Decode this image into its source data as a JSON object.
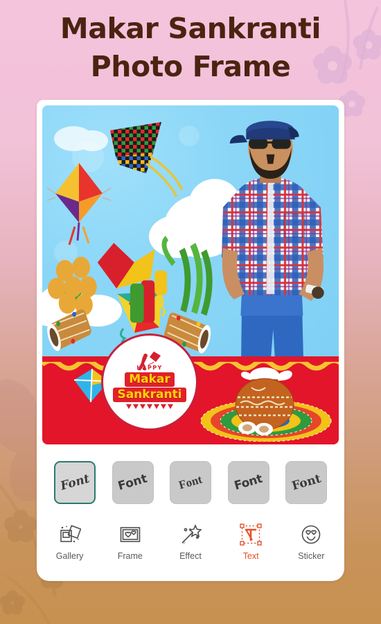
{
  "header": {
    "title_line1": "Makar Sankranti",
    "title_line2": "Photo Frame",
    "title_color": "#4a2411"
  },
  "background": {
    "gradient_top": "#f4c3dd",
    "gradient_bottom": "#c79150",
    "decor": "floral-silhouettes"
  },
  "photo_frame": {
    "theme": "Makar Sankranti kite festival",
    "sky_color": "#8bd6f7",
    "ground_color": "#e3152a",
    "border_color": "#ffffff",
    "badge": {
      "happy": "HAPPY",
      "line1": "Makar",
      "line2": "Sankranti",
      "text_color": "#ffd400",
      "banner_color": "#e1202c"
    },
    "elements": [
      "checkered-kite",
      "purple-orange-kite",
      "yellow-red-kite",
      "small-kite",
      "clouds",
      "man-with-cap-and-sunglasses",
      "plaid-shirt",
      "laddu-pile",
      "dhol-drums",
      "sugarcane",
      "clay-pot-with-rice",
      "coconut-halves",
      "rangoli"
    ]
  },
  "font_strip": {
    "selected_index": 0,
    "selected_border_color": "#2b7a70",
    "tiles": [
      {
        "label": "Font"
      },
      {
        "label": "Font"
      },
      {
        "label": "Font"
      },
      {
        "label": "Font"
      },
      {
        "label": "Font"
      }
    ]
  },
  "bottom_nav": {
    "active_index": 3,
    "active_color": "#e8502a",
    "inactive_color": "#5a5a5a",
    "items": [
      {
        "label": "Gallery",
        "icon": "gallery-icon"
      },
      {
        "label": "Frame",
        "icon": "frame-icon"
      },
      {
        "label": "Effect",
        "icon": "magic-wand-icon"
      },
      {
        "label": "Text",
        "icon": "text-tool-icon"
      },
      {
        "label": "Sticker",
        "icon": "smiley-heart-eyes-icon"
      }
    ]
  }
}
